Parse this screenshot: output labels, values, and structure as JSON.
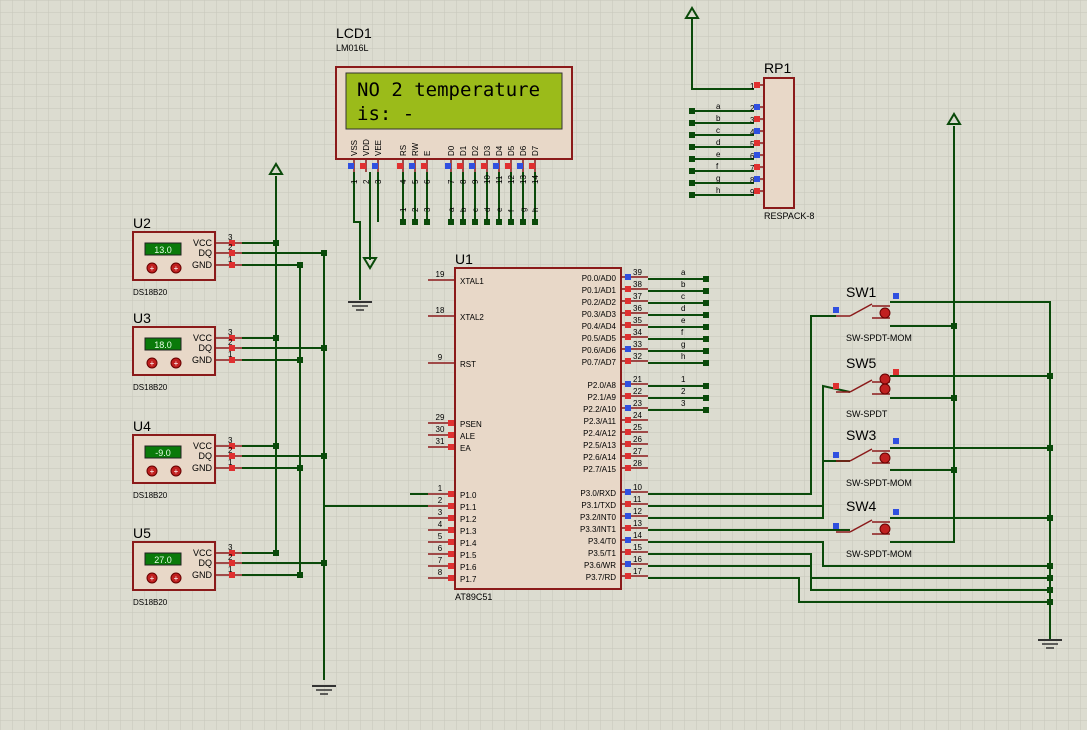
{
  "lcd": {
    "ref": "LCD1",
    "part": "LM016L",
    "line1": "NO 2 temperature",
    "line2": "  is: -",
    "pin_names": [
      "VSS",
      "VDD",
      "VEE",
      "RS",
      "RW",
      "E",
      "D0",
      "D1",
      "D2",
      "D3",
      "D4",
      "D5",
      "D6",
      "D7"
    ],
    "pin_numbers": [
      "1",
      "2",
      "3",
      "4",
      "5",
      "6",
      "7",
      "8",
      "9",
      "10",
      "11",
      "12",
      "13",
      "14"
    ],
    "data_labels": [
      "a",
      "b",
      "c",
      "d",
      "e",
      "f",
      "g",
      "h"
    ]
  },
  "respack": {
    "ref": "RP1",
    "part": "RESPACK-8",
    "pin_numbers": [
      "1",
      "2",
      "3",
      "4",
      "5",
      "6",
      "7",
      "8",
      "9"
    ],
    "net_labels": [
      "a",
      "b",
      "c",
      "d",
      "e",
      "f",
      "g",
      "h"
    ]
  },
  "mcu": {
    "ref": "U1",
    "part": "AT89C51",
    "left_pins": [
      {
        "num": "19",
        "name": "XTAL1"
      },
      {
        "num": "18",
        "name": "XTAL2"
      },
      {
        "num": "9",
        "name": "RST"
      },
      {
        "num": "29",
        "name": "PSEN"
      },
      {
        "num": "30",
        "name": "ALE"
      },
      {
        "num": "31",
        "name": "EA"
      },
      {
        "num": "1",
        "name": "P1.0"
      },
      {
        "num": "2",
        "name": "P1.1"
      },
      {
        "num": "3",
        "name": "P1.2"
      },
      {
        "num": "4",
        "name": "P1.3"
      },
      {
        "num": "5",
        "name": "P1.4"
      },
      {
        "num": "6",
        "name": "P1.5"
      },
      {
        "num": "7",
        "name": "P1.6"
      },
      {
        "num": "8",
        "name": "P1.7"
      }
    ],
    "right_pins": [
      {
        "num": "39",
        "name": "P0.0/AD0",
        "net": "a"
      },
      {
        "num": "38",
        "name": "P0.1/AD1",
        "net": "b"
      },
      {
        "num": "37",
        "name": "P0.2/AD2",
        "net": "c"
      },
      {
        "num": "36",
        "name": "P0.3/AD3",
        "net": "d"
      },
      {
        "num": "35",
        "name": "P0.4/AD4",
        "net": "e"
      },
      {
        "num": "34",
        "name": "P0.5/AD5",
        "net": "f"
      },
      {
        "num": "33",
        "name": "P0.6/AD6",
        "net": "g"
      },
      {
        "num": "32",
        "name": "P0.7/AD7",
        "net": "h"
      },
      {
        "num": "21",
        "name": "P2.0/A8",
        "net": "1"
      },
      {
        "num": "22",
        "name": "P2.1/A9",
        "net": "2"
      },
      {
        "num": "23",
        "name": "P2.2/A10",
        "net": "3"
      },
      {
        "num": "24",
        "name": "P2.3/A11",
        "net": ""
      },
      {
        "num": "25",
        "name": "P2.4/A12",
        "net": ""
      },
      {
        "num": "26",
        "name": "P2.5/A13",
        "net": ""
      },
      {
        "num": "27",
        "name": "P2.6/A14",
        "net": ""
      },
      {
        "num": "28",
        "name": "P2.7/A15",
        "net": ""
      },
      {
        "num": "10",
        "name": "P3.0/RXD",
        "net": ""
      },
      {
        "num": "11",
        "name": "P3.1/TXD",
        "net": ""
      },
      {
        "num": "12",
        "name": "P3.2/INT0",
        "net": ""
      },
      {
        "num": "13",
        "name": "P3.3/INT1",
        "net": ""
      },
      {
        "num": "14",
        "name": "P3.4/T0",
        "net": ""
      },
      {
        "num": "15",
        "name": "P3.5/T1",
        "net": ""
      },
      {
        "num": "16",
        "name": "P3.6/WR",
        "net": ""
      },
      {
        "num": "17",
        "name": "P3.7/RD",
        "net": ""
      }
    ]
  },
  "sensors": [
    {
      "ref": "U2",
      "reading": "13.0",
      "part": "DS18B20"
    },
    {
      "ref": "U3",
      "reading": "18.0",
      "part": "DS18B20"
    },
    {
      "ref": "U4",
      "reading": "-9.0",
      "part": "DS18B20"
    },
    {
      "ref": "U5",
      "reading": "27.0",
      "part": "DS18B20"
    }
  ],
  "sensor_pins": {
    "names": [
      "VCC",
      "DQ",
      "GND"
    ],
    "numbers": [
      "3",
      "2",
      "1"
    ]
  },
  "switches": [
    {
      "ref": "SW1",
      "part": "SW-SPDT-MOM"
    },
    {
      "ref": "SW5",
      "part": "SW-SPDT"
    },
    {
      "ref": "SW3",
      "part": "SW-SPDT-MOM"
    },
    {
      "ref": "SW4",
      "part": "SW-SPDT-MOM"
    }
  ],
  "colors": {
    "background": "#dcdcd0",
    "grid": "#c8c8bc",
    "component_body": "#e8d8c8",
    "component_border": "#8b1a1a",
    "wire": "#0a4a0a",
    "lcd_screen": "#9bbb1a",
    "sensor_display": "#0a7a0a",
    "pin_red": "#e03030",
    "pin_blue": "#3050e0"
  }
}
